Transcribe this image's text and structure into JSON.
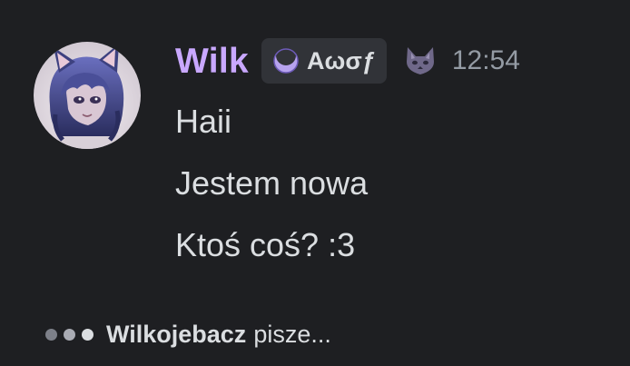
{
  "message": {
    "username": "Wilk",
    "username_color": "#c9a8ff",
    "clan_tag": {
      "label": "Αωσƒ",
      "icon": "crescent-moon-icon"
    },
    "role_icon": "wolf-face-icon",
    "timestamp": "12:54",
    "avatar": "user-avatar",
    "lines": [
      "Haii",
      "Jestem nowa",
      "Ktoś coś? :3"
    ]
  },
  "typing_indicator": {
    "user": "Wilkojebacz",
    "suffix": "pisze...",
    "icon": "typing-dots-icon"
  },
  "colors": {
    "background": "#1e1f22",
    "text": "#dbdee1",
    "muted": "#949ba4",
    "tag_background": "#313338"
  }
}
